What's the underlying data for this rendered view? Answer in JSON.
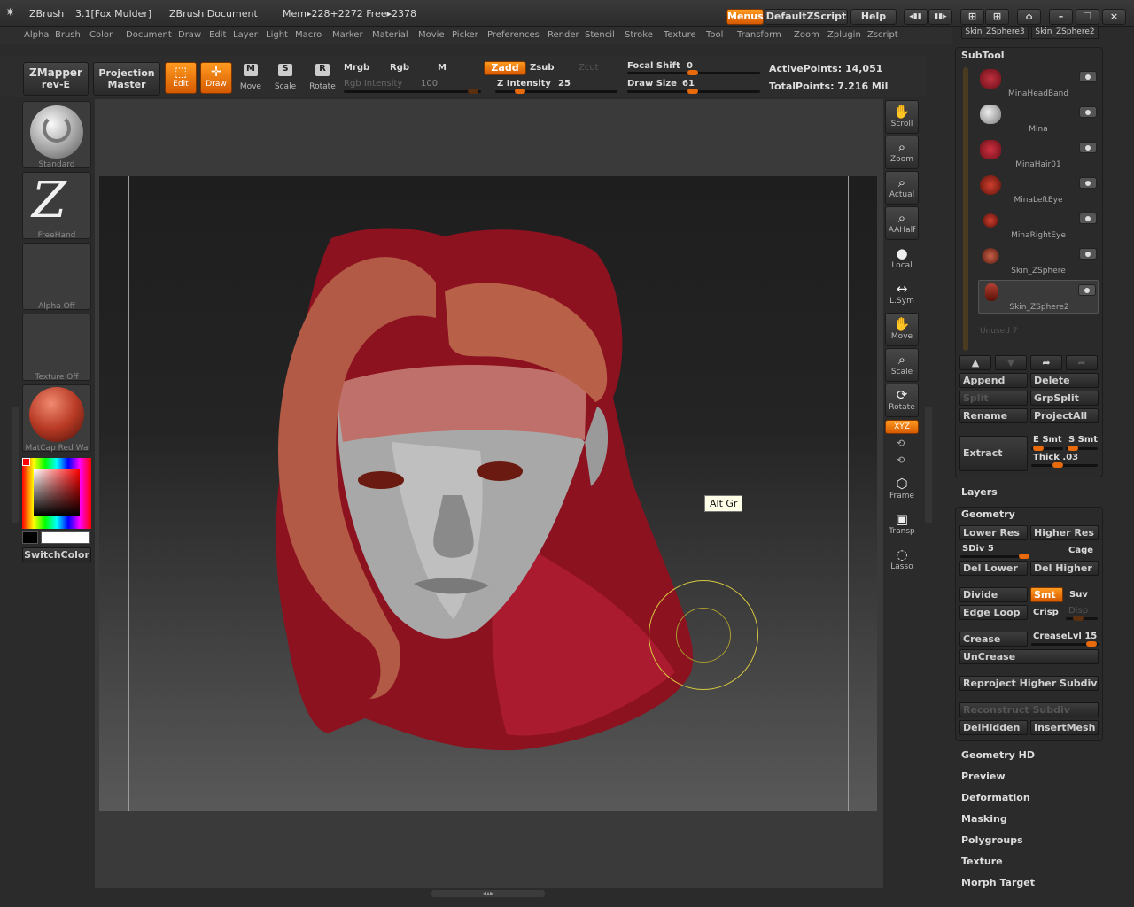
{
  "title": {
    "app": "ZBrush",
    "version": "3.1[Fox Mulder]",
    "doc": "ZBrush Document",
    "mem": "Mem▸228+2272 Free▸2378"
  },
  "header_buttons": {
    "menus": "Menus",
    "script": "DefaultZScript",
    "help": "Help"
  },
  "top_right_tabs": [
    "Skin_ZSphere3",
    "Skin_ZSphere2"
  ],
  "menu_items": [
    "Alpha",
    "Brush",
    "Color",
    "Document",
    "Draw",
    "Edit",
    "Layer",
    "Light",
    "Macro",
    "Marker",
    "Material",
    "Movie",
    "Picker",
    "Preferences",
    "Render",
    "Stencil",
    "Stroke",
    "Texture",
    "Tool",
    "Transform",
    "Zoom",
    "Zplugin",
    "Zscript"
  ],
  "toolbar": {
    "zmapper": "ZMapper",
    "zmapper_sub": "rev-E",
    "projection": "Projection",
    "projection_sub": "Master",
    "edit": "Edit",
    "draw": "Draw",
    "move": "Move",
    "scale": "Scale",
    "rotate": "Rotate",
    "mrgb": "Mrgb",
    "rgb": "Rgb",
    "m": "M",
    "rgb_intensity_label": "Rgb Intensity",
    "rgb_intensity": "100",
    "zadd": "Zadd",
    "zsub": "Zsub",
    "zcut": "Zcut",
    "z_intensity_label": "Z Intensity",
    "z_intensity": "25",
    "focal_shift_label": "Focal Shift",
    "focal_shift": "0",
    "draw_size_label": "Draw Size",
    "draw_size": "61",
    "active_points": "ActivePoints: 14,051",
    "total_points": "TotalPoints: 7.216 Mil"
  },
  "left_shelf": {
    "brush": "Standard",
    "stroke": "FreeHand",
    "alpha": "Alpha Off",
    "texture": "Texture Off",
    "material": "MatCap Red Wa",
    "switch_color": "SwitchColor"
  },
  "right_tools": [
    {
      "name": "scroll",
      "label": "Scroll"
    },
    {
      "name": "zoom",
      "label": "Zoom"
    },
    {
      "name": "actual",
      "label": "Actual"
    },
    {
      "name": "aahalf",
      "label": "AAHalf"
    },
    {
      "name": "local",
      "label": "Local"
    },
    {
      "name": "lsym",
      "label": "L.Sym"
    },
    {
      "name": "move",
      "label": "Move"
    },
    {
      "name": "scale",
      "label": "Scale"
    },
    {
      "name": "rotate",
      "label": "Rotate"
    },
    {
      "name": "xyz",
      "label": "XYZ"
    },
    {
      "name": "frame",
      "label": "Frame"
    },
    {
      "name": "transp",
      "label": "Transp"
    },
    {
      "name": "lasso",
      "label": "Lasso"
    }
  ],
  "tooltip": "Alt Gr",
  "subtool": {
    "title": "SubTool",
    "items": [
      "MinaHeadBand",
      "Mina",
      "MinaHair01",
      "MinaLeftEye",
      "MinaRightEye",
      "Skin_ZSphere",
      "Skin_ZSphere2"
    ],
    "unused": "Unused 7",
    "append": "Append",
    "delete": "Delete",
    "split": "Split",
    "grpsplit": "GrpSplit",
    "rename": "Rename",
    "projectall": "ProjectAll",
    "extract": "Extract",
    "esmt": "E Smt",
    "ssmt": "S Smt",
    "thick": "Thick .03"
  },
  "layers": "Layers",
  "geometry": {
    "title": "Geometry",
    "lower_res": "Lower Res",
    "higher_res": "Higher Res",
    "sdiv": "SDiv 5",
    "cage": "Cage",
    "del_lower": "Del Lower",
    "del_higher": "Del Higher",
    "divide": "Divide",
    "smt": "Smt",
    "suv": "Suv",
    "edge_loop": "Edge Loop",
    "crisp": "Crisp",
    "disp": "Disp",
    "crease": "Crease",
    "crease_lvl": "CreaseLvl 15",
    "uncrease": "UnCrease",
    "reproject": "Reproject Higher Subdiv",
    "reconstruct": "Reconstruct Subdiv",
    "delhidden": "DelHidden",
    "insertmesh": "InsertMesh"
  },
  "sections": [
    "Geometry HD",
    "Preview",
    "Deformation",
    "Masking",
    "Polygroups",
    "Texture",
    "Morph Target"
  ],
  "colors": {
    "accent": "#e8760a",
    "hair_red": "#a01828",
    "skin": "#b8b8b8"
  }
}
